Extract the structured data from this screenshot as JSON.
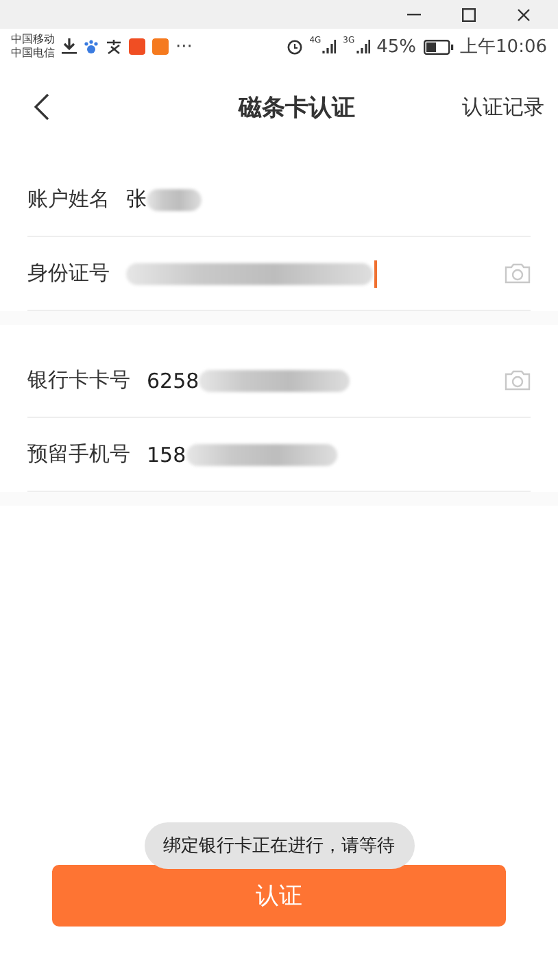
{
  "status_bar": {
    "carriers": [
      "中国移动",
      "中国电信"
    ],
    "more": "···",
    "network_1": "4G",
    "network_2": "3G",
    "battery": "45%",
    "time": "上午10:06"
  },
  "nav": {
    "title": "磁条卡认证",
    "action": "认证记录"
  },
  "sections": [
    {
      "fields": [
        {
          "label": "账户姓名",
          "value": "张",
          "masked": true,
          "camera": false,
          "focused": false
        },
        {
          "label": "身份证号",
          "masked": true,
          "camera": true,
          "focused": true
        }
      ]
    },
    {
      "fields": [
        {
          "label": "银行卡卡号",
          "value": "6258",
          "masked": true,
          "camera": true,
          "focused": false
        },
        {
          "label": "预留手机号",
          "value": "158",
          "masked": true,
          "camera": false,
          "focused": false
        }
      ]
    }
  ],
  "toast": "绑定银行卡正在进行，请等待",
  "submit_button": "认证"
}
